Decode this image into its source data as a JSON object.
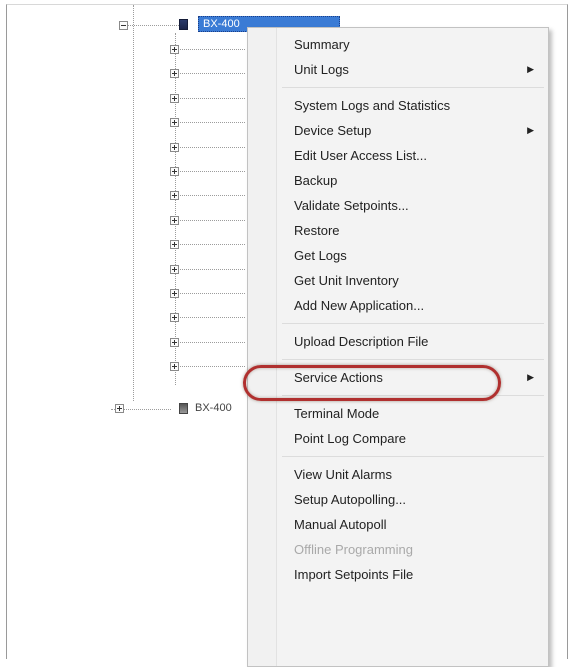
{
  "tree": {
    "selected_node_label": "BX-400",
    "sibling_node_label": "BX-400",
    "child_count": 14
  },
  "context_menu": {
    "groups": [
      [
        {
          "label": "Summary",
          "submenu": false,
          "disabled": false
        },
        {
          "label": "Unit Logs",
          "submenu": true,
          "disabled": false
        }
      ],
      [
        {
          "label": "System Logs and Statistics",
          "submenu": false,
          "disabled": false
        },
        {
          "label": "Device Setup",
          "submenu": true,
          "disabled": false
        },
        {
          "label": "Edit User Access List...",
          "submenu": false,
          "disabled": false
        },
        {
          "label": "Backup",
          "submenu": false,
          "disabled": false
        },
        {
          "label": "Validate Setpoints...",
          "submenu": false,
          "disabled": false
        },
        {
          "label": "Restore",
          "submenu": false,
          "disabled": false
        },
        {
          "label": "Get Logs",
          "submenu": false,
          "disabled": false
        },
        {
          "label": "Get Unit Inventory",
          "submenu": false,
          "disabled": false
        },
        {
          "label": "Add New Application...",
          "submenu": false,
          "disabled": false
        }
      ],
      [
        {
          "label": "Upload Description File",
          "submenu": false,
          "disabled": false,
          "highlighted": true
        }
      ],
      [
        {
          "label": "Service Actions",
          "submenu": true,
          "disabled": false
        }
      ],
      [
        {
          "label": "Terminal Mode",
          "submenu": false,
          "disabled": false
        },
        {
          "label": "Point Log Compare",
          "submenu": false,
          "disabled": false
        }
      ],
      [
        {
          "label": "View Unit Alarms",
          "submenu": false,
          "disabled": false
        },
        {
          "label": "Setup Autopolling...",
          "submenu": false,
          "disabled": false
        },
        {
          "label": "Manual Autopoll",
          "submenu": false,
          "disabled": false
        },
        {
          "label": "Offline Programming",
          "submenu": false,
          "disabled": true
        },
        {
          "label": "Import Setpoints File",
          "submenu": false,
          "disabled": false
        }
      ]
    ],
    "submenu_arrow": "▶",
    "highlight_color": "#b0302f"
  }
}
